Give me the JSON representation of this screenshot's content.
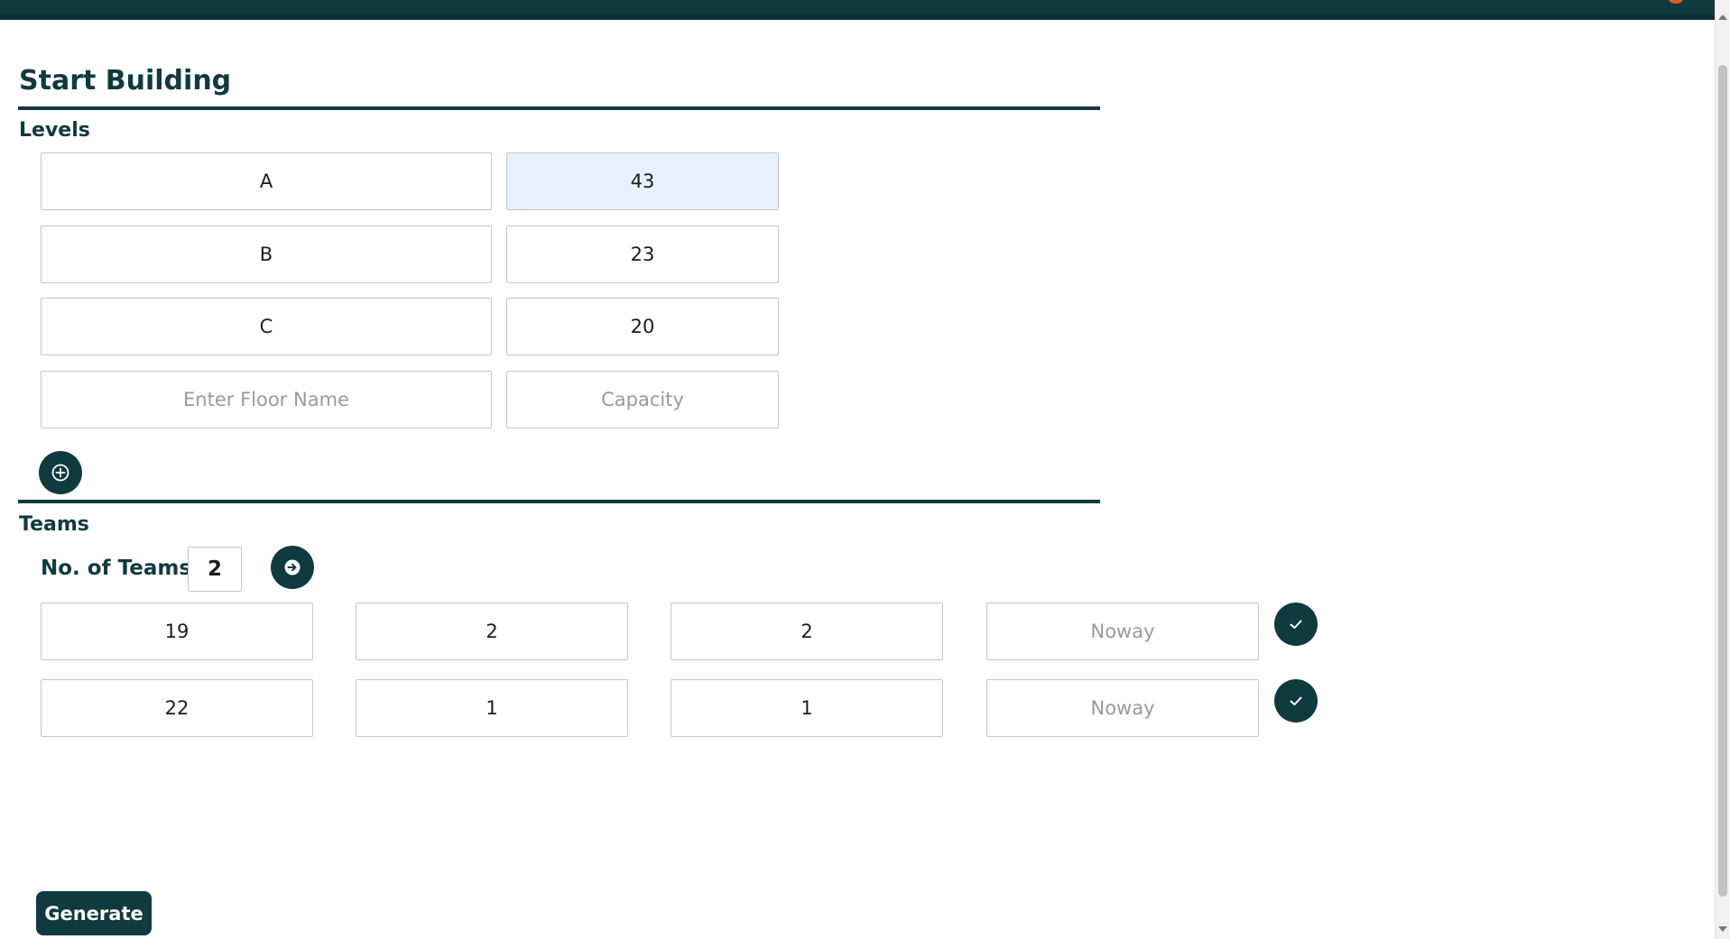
{
  "page": {
    "title": "Start Building",
    "generate_label": "Generate"
  },
  "levels": {
    "label": "Levels",
    "rows": [
      {
        "name": "A",
        "capacity": "43"
      },
      {
        "name": "B",
        "capacity": "23"
      },
      {
        "name": "C",
        "capacity": "20"
      }
    ],
    "new_row": {
      "name_placeholder": "Enter Floor Name",
      "capacity_placeholder": "Capacity"
    }
  },
  "teams": {
    "label": "Teams",
    "count_label": "No. of Teams",
    "count_value": "2",
    "rows": [
      {
        "size": "19",
        "col2": "2",
        "col3": "2",
        "note_placeholder": "Noway"
      },
      {
        "size": "22",
        "col2": "1",
        "col3": "1",
        "note_placeholder": "Noway"
      }
    ]
  },
  "icons": {
    "add_level": "plus-circle-icon",
    "teams_go": "arrow-right-circle-icon",
    "confirm": "check-icon"
  },
  "colors": {
    "primary": "#0f3a3f",
    "autofill_highlight": "#e8f0fe",
    "border": "#c6c6c6",
    "placeholder": "#9a9a9a"
  }
}
